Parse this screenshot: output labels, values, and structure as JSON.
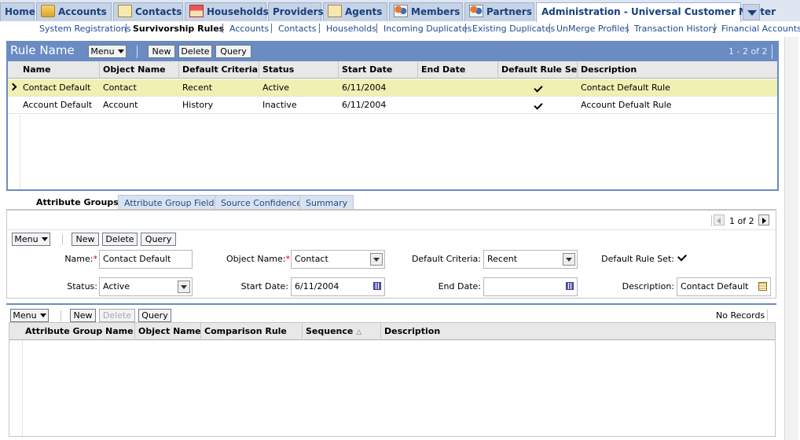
{
  "tabs": [
    {
      "label": "Home",
      "icon": "none"
    },
    {
      "label": "Accounts",
      "icon": "folder-icon"
    },
    {
      "label": "Contacts",
      "icon": "contact-card-icon"
    },
    {
      "label": "Households",
      "icon": "house-icon"
    },
    {
      "label": "Providers",
      "icon": "none"
    },
    {
      "label": "Agents",
      "icon": "contact-card-icon"
    },
    {
      "label": "Members",
      "icon": "people-icon"
    },
    {
      "label": "Partners",
      "icon": "people-icon"
    },
    {
      "label": "Administration - Universal Customer Master",
      "icon": "none",
      "active": true
    }
  ],
  "subnav": [
    {
      "label": "System Registrations"
    },
    {
      "label": "Survivorship Rules",
      "current": true
    },
    {
      "label": "Accounts"
    },
    {
      "label": "Contacts"
    },
    {
      "label": "Households"
    },
    {
      "label": "Incoming Duplicates"
    },
    {
      "label": "Existing Duplicates"
    },
    {
      "label": "UnMerge Profiles"
    },
    {
      "label": "Transaction History"
    },
    {
      "label": "Financial Accounts"
    }
  ],
  "rule_applet": {
    "title": "Rule Name",
    "menu_label": "Menu",
    "new_label": "New",
    "delete_label": "Delete",
    "query_label": "Query",
    "record_count": "1 - 2 of 2",
    "columns": [
      "Name",
      "Object Name",
      "Default Criteria",
      "Status",
      "Start Date",
      "End Date",
      "Default Rule Set",
      "Description"
    ],
    "rows": [
      {
        "name": "Contact Default",
        "object_name": "Contact",
        "criteria": "Recent",
        "status": "Active",
        "start_date": "6/11/2004",
        "end_date": "",
        "default_rule_set": true,
        "description": "Contact Default Rule",
        "selected": true
      },
      {
        "name": "Account Default",
        "object_name": "Account",
        "criteria": "History",
        "status": "Inactive",
        "start_date": "6/11/2004",
        "end_date": "",
        "default_rule_set": true,
        "description": "Account Defualt Rule",
        "selected": false
      }
    ]
  },
  "detail_tabs": [
    {
      "label": "Attribute Groups",
      "active": true
    },
    {
      "label": "Attribute Group Fields"
    },
    {
      "label": "Source Confidence"
    },
    {
      "label": "Summary"
    }
  ],
  "form": {
    "pager": "1 of 2",
    "menu_label": "Menu",
    "new_label": "New",
    "delete_label": "Delete",
    "query_label": "Query",
    "name_label": "Name:",
    "name_value": "Contact Default",
    "object_name_label": "Object Name:",
    "object_name_value": "Contact",
    "default_criteria_label": "Default Criteria:",
    "default_criteria_value": "Recent",
    "default_rule_set_label": "Default Rule Set:",
    "default_rule_set_checked": true,
    "status_label": "Status:",
    "status_value": "Active",
    "start_date_label": "Start Date:",
    "start_date_value": "6/11/2004",
    "end_date_label": "End Date:",
    "end_date_value": "",
    "description_label": "Description:",
    "description_value": "Contact Default"
  },
  "attr_list": {
    "menu_label": "Menu",
    "new_label": "New",
    "delete_label": "Delete",
    "query_label": "Query",
    "record_status": "No Records",
    "columns": [
      "Attribute Group Name",
      "Object Name",
      "Comparison Rule",
      "Sequence",
      "Description"
    ],
    "sort_indicator": "△"
  },
  "colors": {
    "tab_text": "#17407e",
    "link": "#1e4a8f",
    "applet_header": "#6a8cc3",
    "selected_row": "#f1f0b3",
    "required": "#d00000"
  }
}
